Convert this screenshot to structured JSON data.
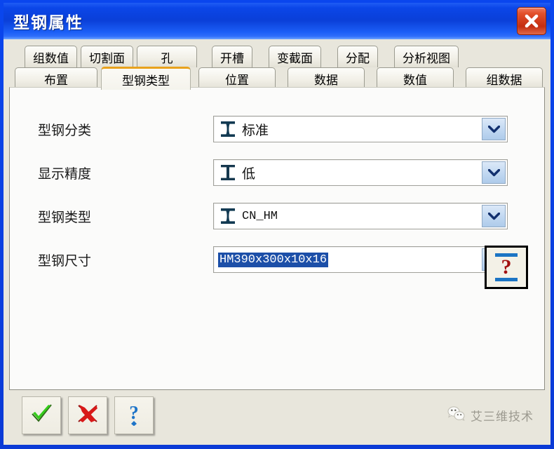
{
  "window": {
    "title": "型钢属性",
    "close_icon": "close-icon",
    "accent_color": "#0a3fd8",
    "active_tab_accent": "#e8a21d"
  },
  "tabs": {
    "row1": [
      {
        "label": "组数值",
        "active": false
      },
      {
        "label": "切割面",
        "active": false
      },
      {
        "label": "孔",
        "active": false
      },
      {
        "label": "开槽",
        "active": false
      },
      {
        "label": "变截面",
        "active": false
      },
      {
        "label": "分配",
        "active": false
      },
      {
        "label": "分析视图",
        "active": false
      }
    ],
    "row2": [
      {
        "label": "布置",
        "active": false
      },
      {
        "label": "型钢类型",
        "active": true
      },
      {
        "label": "位置",
        "active": false
      },
      {
        "label": "数据",
        "active": false
      },
      {
        "label": "数值",
        "active": false
      },
      {
        "label": "组数据",
        "active": false
      }
    ]
  },
  "form": {
    "fields": [
      {
        "label": "型钢分类",
        "value": "标准",
        "icon": "i-beam-tapered-icon",
        "selected": false,
        "cjk": true
      },
      {
        "label": "显示精度",
        "value": "低",
        "icon": "i-beam-straight-icon",
        "selected": false,
        "cjk": true
      },
      {
        "label": "型钢类型",
        "value": "CN_HM",
        "icon": "i-beam-tapered-icon",
        "selected": false,
        "cjk": false
      },
      {
        "label": "型钢尺寸",
        "value": "HM390x300x10x16",
        "icon": "none",
        "selected": true,
        "cjk": false
      }
    ],
    "dropdown_arrow_icon": "chevron-down-icon",
    "profile_select": {
      "icon": "i-beam-help-icon",
      "question_mark": "?"
    }
  },
  "bottom": {
    "buttons": [
      {
        "name": "ok-button",
        "icon": "green-check-icon"
      },
      {
        "name": "cancel-button",
        "icon": "red-x-icon"
      },
      {
        "name": "help-button",
        "icon": "blue-question-icon"
      }
    ],
    "watermark": {
      "icon": "wechat-icon",
      "text": "艾三维技术"
    }
  }
}
